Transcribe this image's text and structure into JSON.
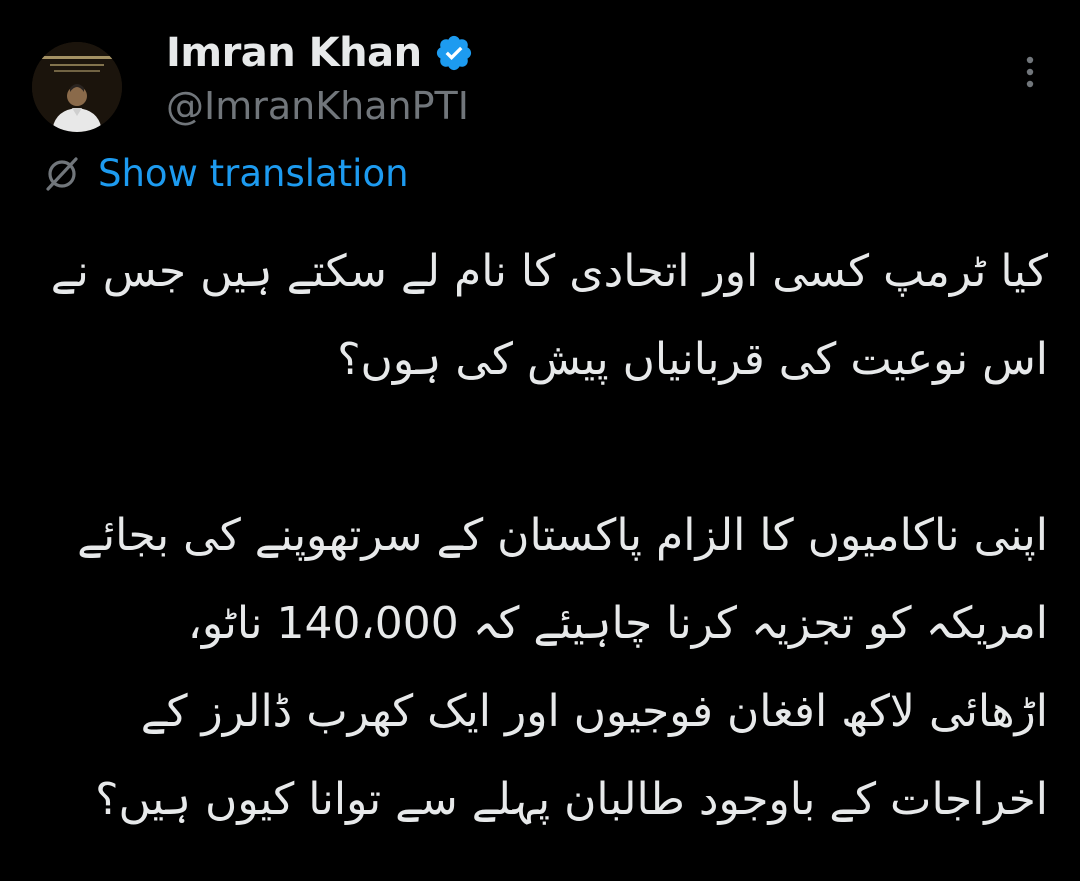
{
  "author": {
    "display_name": "Imran Khan",
    "handle": "@ImranKhanPTI",
    "verified": true,
    "avatar_icon": "profile-photo",
    "verified_icon": "verified-badge-icon",
    "verified_color": "#1d9bf0"
  },
  "actions": {
    "more_icon": "more-vertical-icon",
    "translate_icon": "globe-slash-icon",
    "translate_label": "Show translation",
    "link_color": "#1d9bf0"
  },
  "tweet": {
    "paragraphs": [
      {
        "lines": [
          "کیا ٹرمپ کسی اور اتحادی کا نام لے سکتے ہیں جس نے",
          "اس نوعیت کی قربانیاں پیش کی ہوں؟"
        ]
      },
      {
        "lines": [
          "اپنی ناکامیوں کا الزام پاکستان کے سرتھوپنے کی بجائے",
          "امریکہ کو تجزیہ کرنا چاہیئے کہ 140،000 ناٹو،",
          "اڑھائی لاکھ افغان فوجیوں اور ایک کھرب ڈالرز کے",
          "اخراجات کے باوجود طالبان پہلے سے توانا کیوں ہیں؟"
        ]
      }
    ]
  },
  "theme": {
    "background": "#000000",
    "text": "#e7e9ea",
    "secondary_text": "#71767b"
  }
}
